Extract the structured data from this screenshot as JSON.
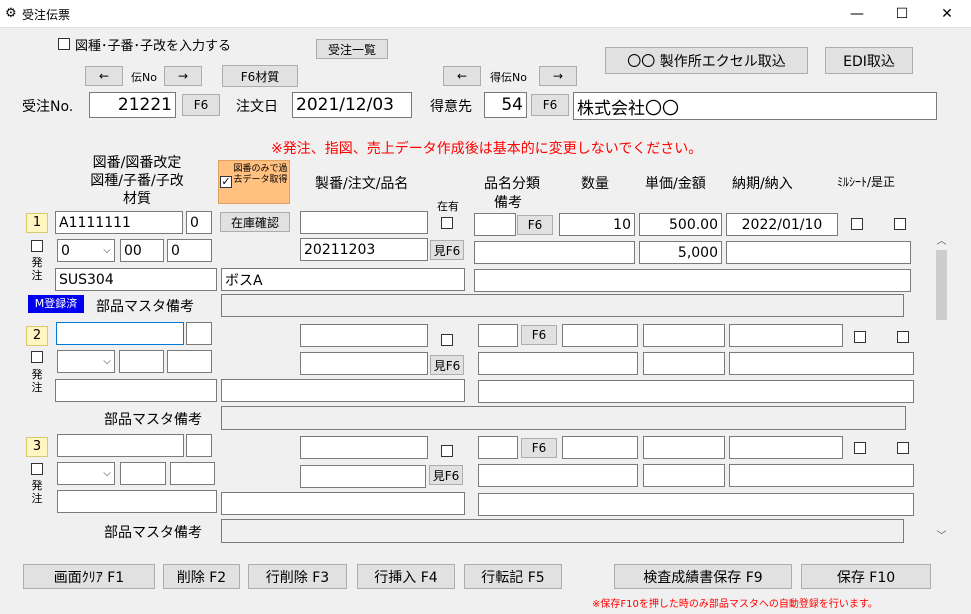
{
  "window": {
    "title": "受注伝票",
    "minimize": "—",
    "maximize": "☐",
    "close": "✕"
  },
  "header": {
    "checkbox_label": "図種･子番･子改を入力する",
    "order_list_btn": "受注一覧",
    "prev_label": "←",
    "next_label": "→",
    "slip_no_label": "伝No",
    "f6_material_btn": "F6材質",
    "cust_slip_label": "得伝No",
    "excel_import_btn": "〇〇 製作所エクセル取込",
    "edi_import_btn": "EDI取込",
    "order_no_label": "受注No.",
    "order_no": "21221",
    "f6": "F6",
    "order_date_label": "注文日",
    "order_date": "2021/12/03",
    "customer_label": "得意先",
    "customer_code": "54",
    "customer_name": "株式会社〇〇",
    "warning": "※発注、指図、売上データ作成後は基本的に変更しないでください。"
  },
  "columns": {
    "drawing_line1": "図番/図番改定",
    "drawing_line2": "図種/子番/子改",
    "drawing_line3": "材質",
    "past_data_btn": "図番のみで過去データ取得",
    "seiban": "製番/注文/品名",
    "in_stock": "在有",
    "product_cat": "品名分類",
    "remarks": "備考",
    "qty": "数量",
    "unit_price": "単価/金額",
    "delivery": "納期/納入",
    "mill_sheet": "ﾐﾙｼｰﾄ/是正"
  },
  "rows": [
    {
      "no": "1",
      "drawing_no": "A1111111",
      "drawing_rev": "0",
      "stock_check_btn": "在庫確認",
      "type_sel": "0",
      "sub_no": "00",
      "sub_rev": "0",
      "order_no": "20211203",
      "mi_f6": "見F6",
      "material": "SUS304",
      "product_name": "ボスA",
      "qty": "10",
      "unit_price": "500.00",
      "amount": "5,000",
      "delivery": "2022/01/10",
      "hacchu": "発注",
      "m_badge": "M登録済",
      "parts_remark_label": "部品マスタ備考"
    },
    {
      "no": "2",
      "mi_f6": "見F6",
      "hacchu": "発注",
      "parts_remark_label": "部品マスタ備考"
    },
    {
      "no": "3",
      "mi_f6": "見F6",
      "hacchu": "発注",
      "parts_remark_label": "部品マスタ備考"
    }
  ],
  "footer": {
    "clear_btn": "画面ｸﾘｱ F1",
    "delete_btn": "削除 F2",
    "row_delete_btn": "行削除 F3",
    "row_insert_btn": "行挿入 F4",
    "row_copy_btn": "行転記 F5",
    "inspection_btn": "検査成績書保存 F9",
    "save_btn": "保存 F10",
    "note": "※保存F10を押した時のみ部品マスタへの自動登録を行います。"
  }
}
